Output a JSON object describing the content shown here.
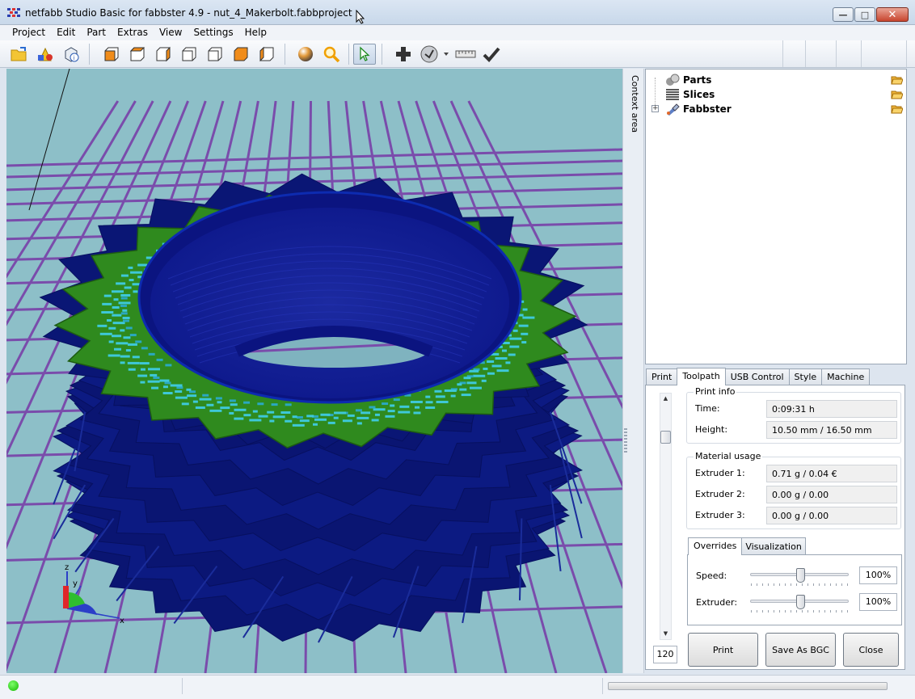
{
  "window": {
    "title": "netfabb Studio Basic for fabbster 4.9 - nut_4_Makerbolt.fabbproject",
    "minimize_glyph": "—",
    "maximize_glyph": "□",
    "close_glyph": "✕"
  },
  "menu": [
    "Project",
    "Edit",
    "Part",
    "Extras",
    "View",
    "Settings",
    "Help"
  ],
  "toolbar_icons": [
    "open-project-icon",
    "add-part-icon",
    "part-info-icon",
    "view-front-icon",
    "view-back-icon",
    "view-left-icon",
    "view-right-icon",
    "view-top-icon",
    "view-bottom-icon",
    "view-perspective-icon",
    "render-sphere-icon",
    "zoom-icon",
    "select-arrow-icon",
    "add-icon",
    "repair-icon",
    "measure-icon",
    "checkmark-icon"
  ],
  "viewport": {
    "axis_x": "x",
    "axis_y": "y",
    "axis_z": "z"
  },
  "context_area_label": "Context area",
  "tree": {
    "items": [
      {
        "label": "Parts",
        "icon": "parts-icon"
      },
      {
        "label": "Slices",
        "icon": "slices-icon"
      },
      {
        "label": "Fabbster",
        "icon": "fabbster-icon",
        "expand": "+"
      }
    ]
  },
  "tabs": [
    "Print",
    "Toolpath",
    "USB Control",
    "Style",
    "Machine"
  ],
  "active_tab": "Toolpath",
  "print_info": {
    "title": "Print info",
    "time_label": "Time:",
    "time_value": "0:09:31 h",
    "height_label": "Height:",
    "height_value": "10.50 mm / 16.50 mm"
  },
  "material_usage": {
    "title": "Material usage",
    "extruders": [
      {
        "label": "Extruder 1:",
        "value": "0.71 g / 0.04 €"
      },
      {
        "label": "Extruder 2:",
        "value": "0.00 g / 0.00"
      },
      {
        "label": "Extruder 3:",
        "value": "0.00 g / 0.00"
      }
    ]
  },
  "override_tabs": [
    "Overrides",
    "Visualization"
  ],
  "overrides": {
    "speed_label": "Speed:",
    "speed_value": "100%",
    "speed_level": 0.5,
    "extruder_label": "Extruder:",
    "extruder_value": "100%",
    "extruder_level": 0.5
  },
  "layer_value": "120",
  "buttons": {
    "print": "Print",
    "save_bgc": "Save As BGC",
    "close": "Close"
  },
  "colors": {
    "model_blue": "#0a1a7d",
    "model_green": "#2f8a1e",
    "infill_cyan": "#3ec8d8",
    "grid_purple": "#7a4cab",
    "background": "#8dbfc8"
  }
}
